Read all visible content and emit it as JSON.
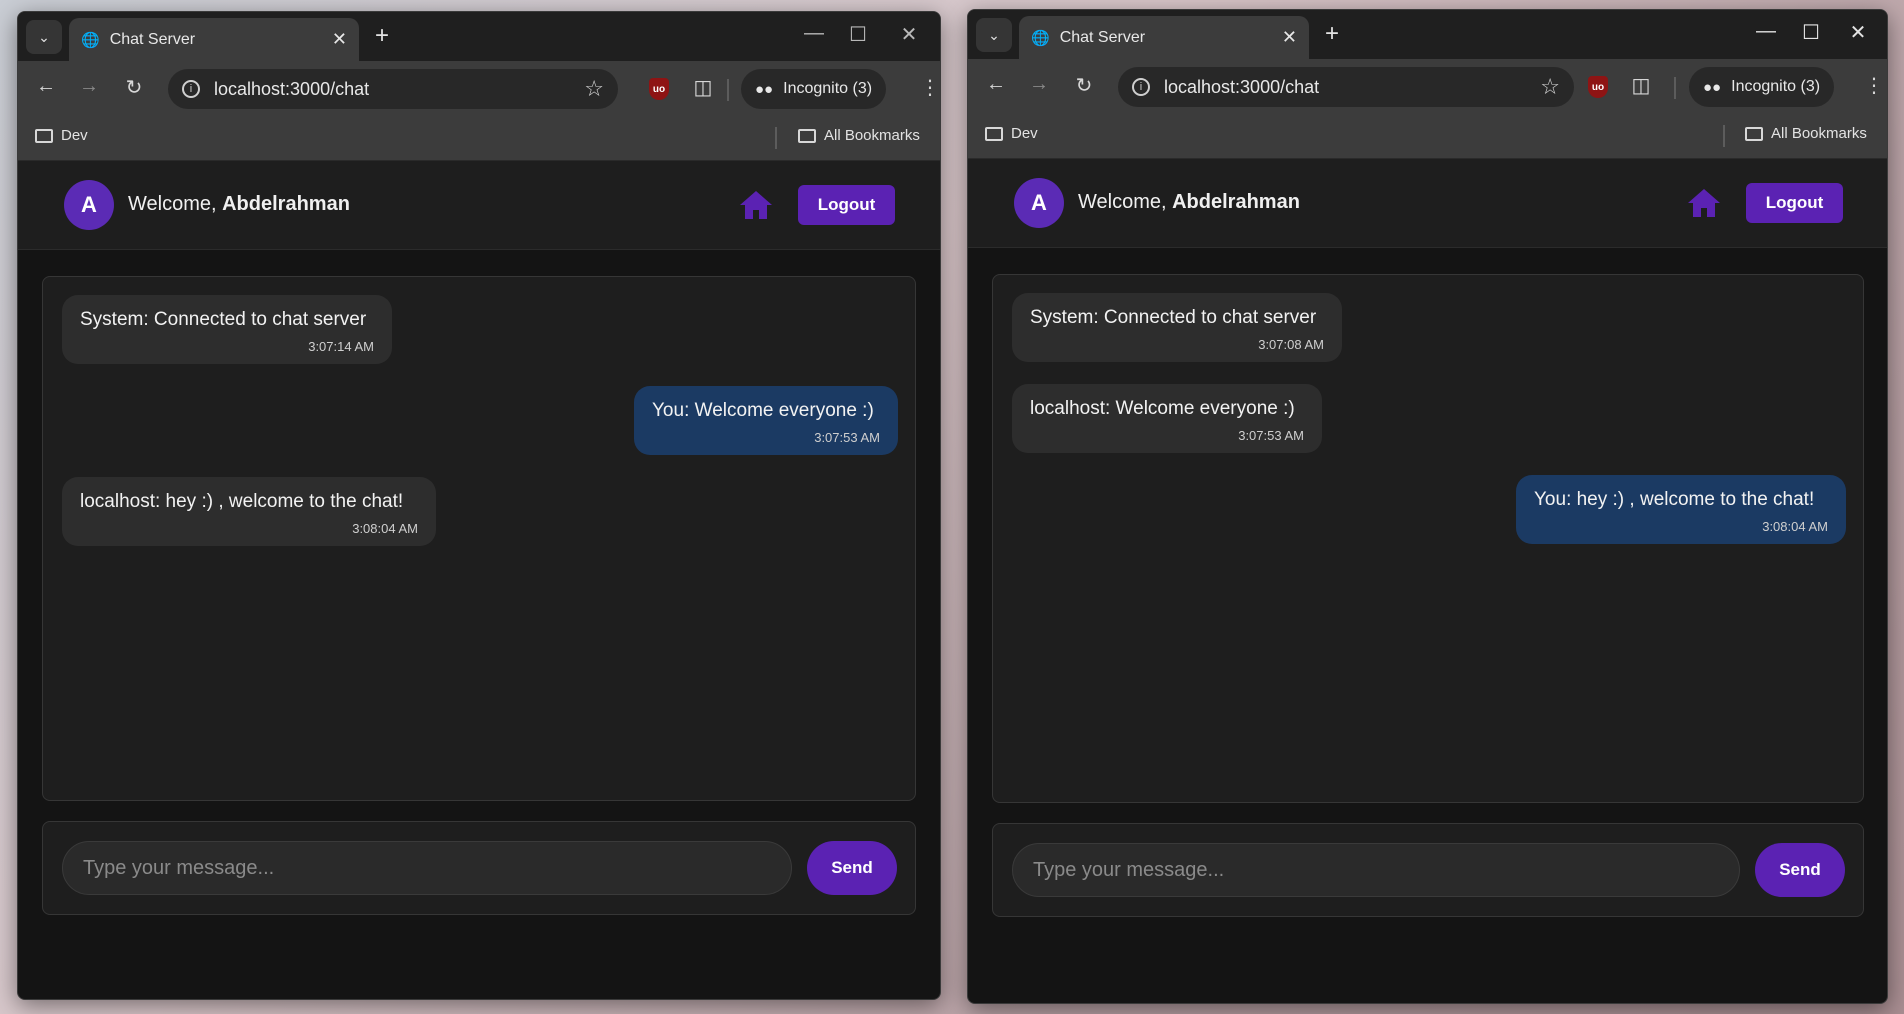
{
  "browser": {
    "tab_title": "Chat Server",
    "url": "localhost:3000/chat",
    "incognito_label": "Incognito (3)",
    "bookmark_dev": "Dev",
    "bookmark_all": "All Bookmarks"
  },
  "app": {
    "welcome_prefix": "Welcome, ",
    "username": "Abdelrahman",
    "avatar_letter": "A",
    "logout_label": "Logout",
    "input_placeholder": "Type your message...",
    "send_label": "Send",
    "accent_color": "#5b22b3",
    "self_bubble_color": "#1b3a63"
  },
  "left_window": {
    "messages": [
      {
        "text": "System: Connected to chat server",
        "time": "3:07:14 AM",
        "from": "other"
      },
      {
        "text": "You: Welcome everyone :)",
        "time": "3:07:53 AM",
        "from": "self"
      },
      {
        "text": "localhost: hey :) , welcome to the chat!",
        "time": "3:08:04 AM",
        "from": "other"
      }
    ]
  },
  "right_window": {
    "messages": [
      {
        "text": "System: Connected to chat server",
        "time": "3:07:08 AM",
        "from": "other"
      },
      {
        "text": "localhost: Welcome everyone :)",
        "time": "3:07:53 AM",
        "from": "other"
      },
      {
        "text": "You: hey :) , welcome to the chat!",
        "time": "3:08:04 AM",
        "from": "self"
      }
    ]
  }
}
